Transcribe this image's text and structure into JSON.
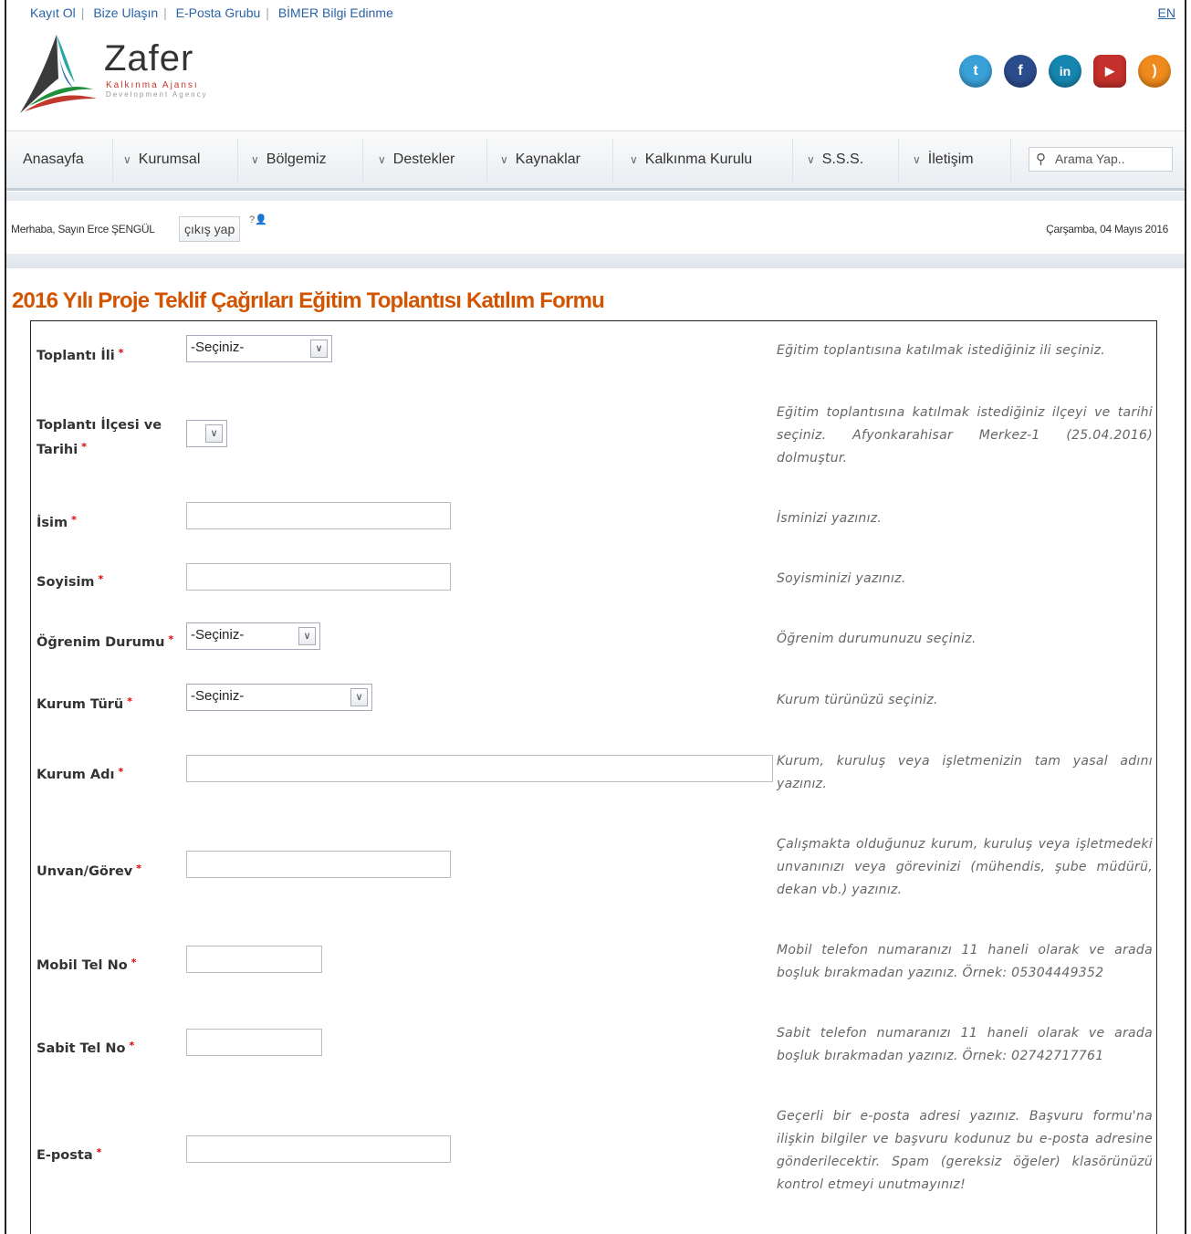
{
  "top_links": [
    "Kayıt Ol",
    "Bize Ulaşın",
    "E-Posta Grubu",
    "BİMER Bilgi Edinme"
  ],
  "lang": "EN",
  "logo": {
    "name": "Zafer",
    "sub1": "Kalkınma Ajansı",
    "sub2": "Development Agency"
  },
  "social": [
    {
      "icon": "twitter-icon",
      "glyph": "t",
      "color": "#3aa0d8"
    },
    {
      "icon": "facebook-icon",
      "glyph": "f",
      "color": "#2b4c8c"
    },
    {
      "icon": "linkedin-icon",
      "glyph": "in",
      "color": "#1686b0"
    },
    {
      "icon": "youtube-icon",
      "glyph": "▶",
      "color": "#c4302b"
    },
    {
      "icon": "rss-icon",
      "glyph": ")",
      "color": "#ef8a1c"
    }
  ],
  "nav": {
    "items": [
      "Anasayfa",
      "Kurumsal",
      "Bölgemiz",
      "Destekler",
      "Kaynaklar",
      "Kalkınma Kurulu",
      "S.S.S.",
      "İletişim"
    ],
    "search_placeholder": "Arama Yap.."
  },
  "user": {
    "greeting": "Merhaba, Sayın Erce ŞENGÜL",
    "logout": "çıkış yap",
    "help": "?",
    "date": "Çarşamba, 04 Mayıs 2016"
  },
  "page_title": "2016 Yılı Proje Teklif Çağrıları Eğitim Toplantısı Katılım Formu",
  "form": {
    "toplanti_ili": {
      "label": "Toplantı İli",
      "value": "-Seçiniz-",
      "help": "Eğitim toplantısına katılmak istediğiniz ili seçiniz."
    },
    "toplanti_ilcesi": {
      "label": "Toplantı İlçesi ve Tarihi",
      "value": "",
      "help": "Eğitim toplantısına katılmak istediğiniz ilçeyi ve tarihi seçiniz. Afyonkarahisar Merkez-1 (25.04.2016) dolmuştur."
    },
    "isim": {
      "label": "İsim",
      "value": "",
      "help": "İsminizi yazınız."
    },
    "soyisim": {
      "label": "Soyisim",
      "value": "",
      "help": "Soyisminizi yazınız."
    },
    "ogrenim": {
      "label": "Öğrenim Durumu",
      "value": "-Seçiniz-",
      "help": "Öğrenim durumunuzu seçiniz."
    },
    "kurum_turu": {
      "label": "Kurum Türü",
      "value": "-Seçiniz-",
      "help": "Kurum türünüzü seçiniz."
    },
    "kurum_adi": {
      "label": "Kurum Adı",
      "value": "",
      "help": "Kurum, kuruluş veya işletmenizin tam yasal adını yazınız."
    },
    "unvan": {
      "label": "Unvan/Görev",
      "value": "",
      "help": "Çalışmakta olduğunuz kurum, kuruluş veya işletmedeki unvanınızı veya görevinizi (mühendis, şube müdürü, dekan vb.) yazınız."
    },
    "mobil": {
      "label": "Mobil Tel No",
      "value": "",
      "help": "Mobil telefon numaranızı 11 haneli olarak ve arada boşluk bırakmadan yazınız. Örnek: 05304449352"
    },
    "sabit": {
      "label": "Sabit Tel No",
      "value": "",
      "help": "Sabit telefon numaranızı 11 haneli olarak ve arada boşluk bırakmadan yazınız. Örnek: 02742717761"
    },
    "eposta": {
      "label": "E-posta",
      "value": "",
      "help": "Geçerli bir e-posta adresi yazınız. Başvuru formu'na ilişkin bilgiler ve başvuru kodunuz bu e-posta adresine gönderilecektir. Spam (gereksiz öğeler) klasörünüzü kontrol etmeyi unutmayınız!"
    },
    "required_mark": "*"
  }
}
